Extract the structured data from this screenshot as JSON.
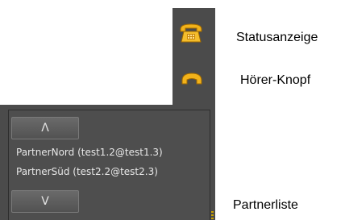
{
  "annotations": {
    "status": "Statusanzeige",
    "hoerer": "Hörer-Knopf",
    "partnerliste": "Partnerliste"
  },
  "status_icon": "telephone-icon",
  "handset_icon": "handset-icon",
  "partner_list": {
    "up_label": "Λ",
    "down_label": "V",
    "items": [
      "PartnerNord (test1.2@test1.3)",
      "PartnerSüd (test2.2@test2.3)"
    ]
  },
  "colors": {
    "panel": "#4b4b4b",
    "icon_orange": "#f2b21a",
    "text": "#e8e8e8"
  }
}
